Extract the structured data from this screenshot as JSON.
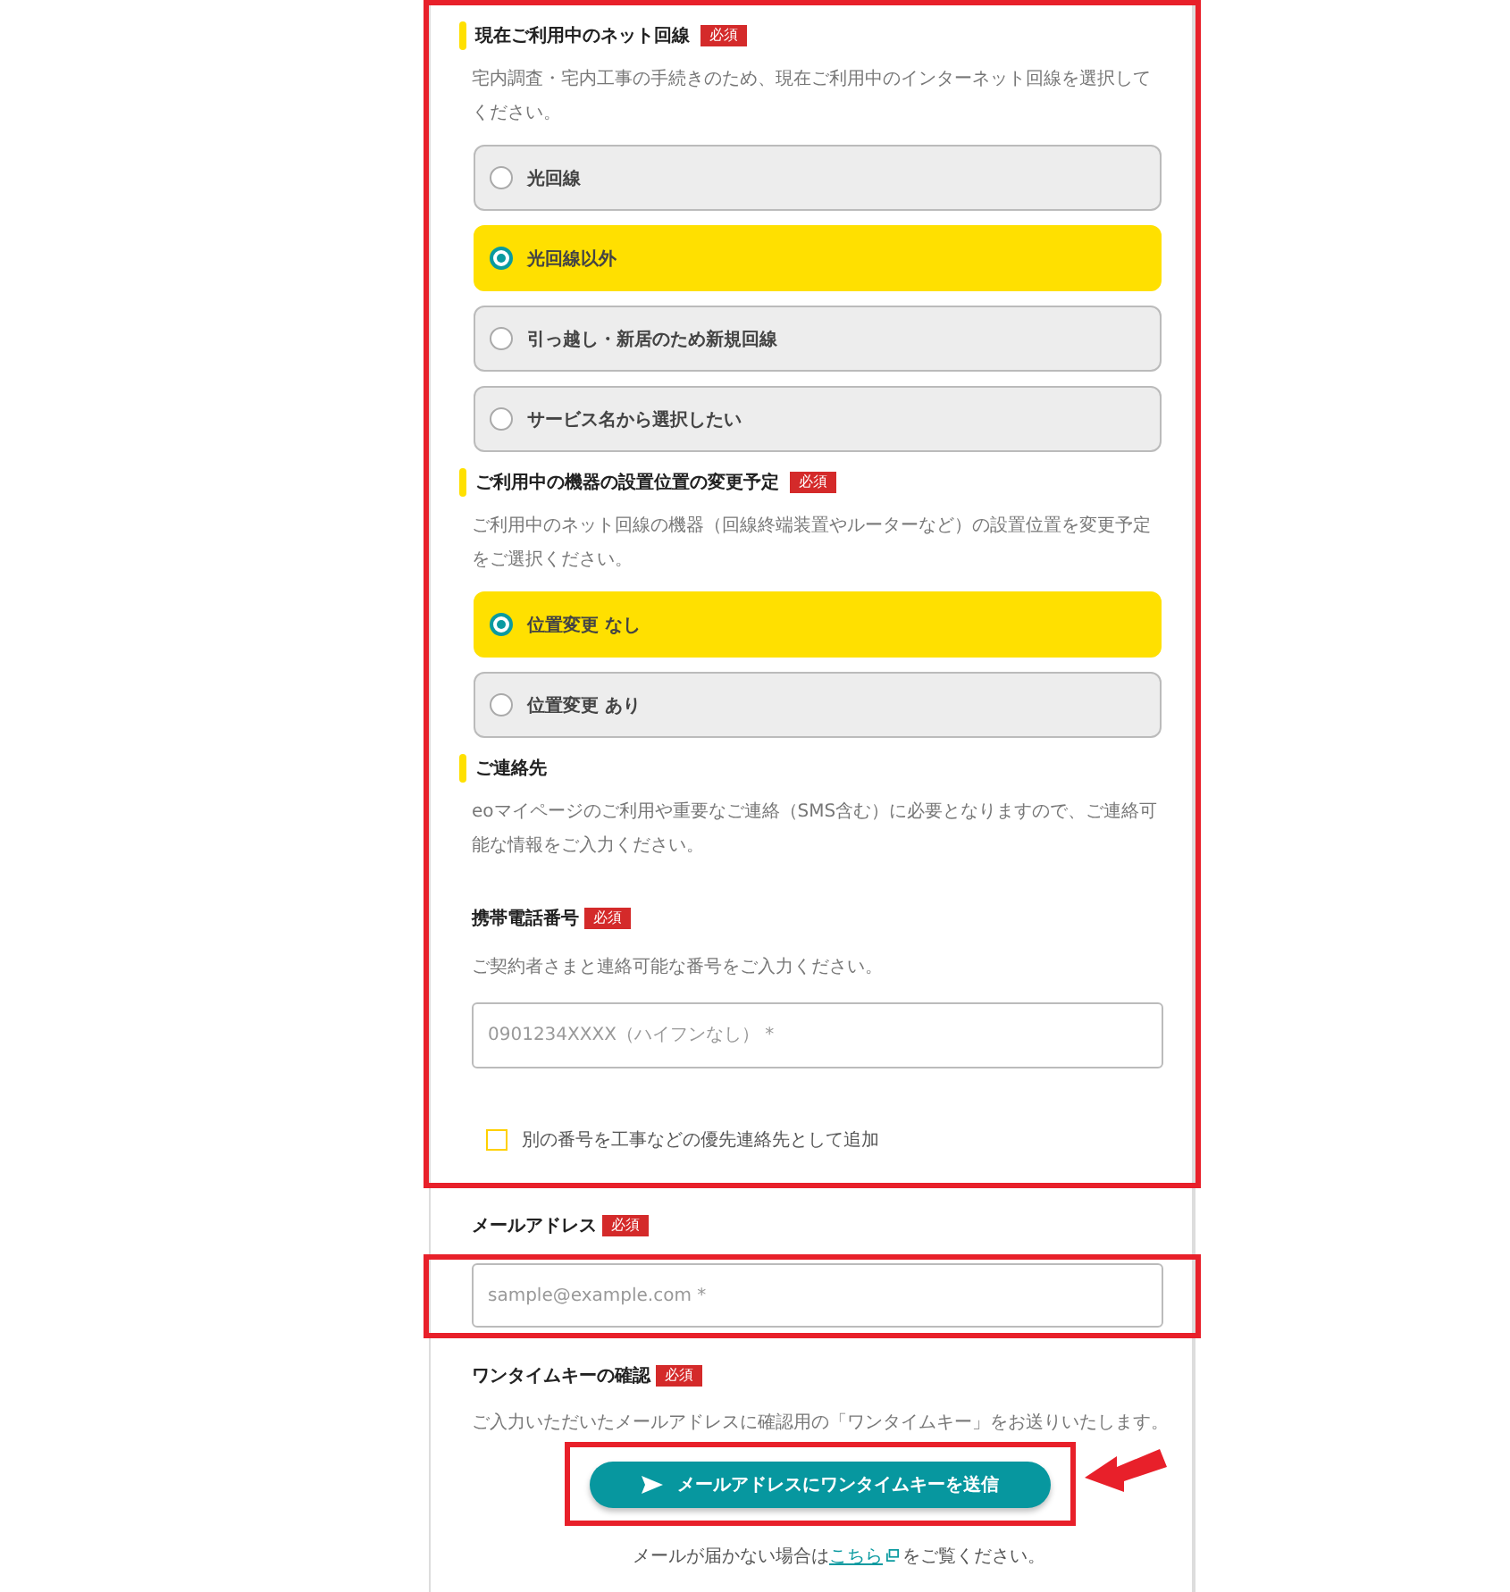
{
  "radio_sections": [
    {
      "title": "現在ご利用中のネット回線",
      "badge": "必須",
      "description": "宅内調査・宅内工事の手続きのため、現在ご利用中のインターネット回線を選択してください。",
      "options": [
        {
          "label": "光回線",
          "selected": false
        },
        {
          "label": "光回線以外",
          "selected": true
        },
        {
          "label": "引っ越し・新居のため新規回線",
          "selected": false
        },
        {
          "label": "サービス名から選択したい",
          "selected": false
        }
      ]
    },
    {
      "title": "ご利用中の機器の設置位置の変更予定",
      "badge": "必須",
      "description": "ご利用中のネット回線の機器（回線終端装置やルーターなど）の設置位置を変更予定をご選択ください。",
      "options": [
        {
          "label": "位置変更 なし",
          "selected": true
        },
        {
          "label": "位置変更 あり",
          "selected": false
        }
      ]
    }
  ],
  "contact": {
    "title": "ご連絡先",
    "description": "eoマイページのご利用や重要なご連絡（SMS含む）に必要となりますので、ご連絡可能な情報をご入力ください。"
  },
  "phone": {
    "label": "携帯電話番号",
    "badge": "必須",
    "description": "ご契約者さまと連絡可能な番号をご入力ください。",
    "placeholder": "0901234XXXX（ハイフンなし） *",
    "checkbox": {
      "label": "別の番号を工事などの優先連絡先として追加",
      "checked": false
    }
  },
  "email": {
    "label": "メールアドレス",
    "badge": "必須",
    "placeholder": "sample@example.com *"
  },
  "onetime_key": {
    "label": "ワンタイムキーの確認",
    "badge": "必須",
    "description": "ご入力いただいたメールアドレスに確認用の「ワンタイムキー」をお送りいたします。",
    "button": "メールアドレスにワンタイムキーを送信",
    "note": {
      "before": "メールが届かない場合は",
      "link": "こちら",
      "after": "をご覧ください。"
    }
  }
}
